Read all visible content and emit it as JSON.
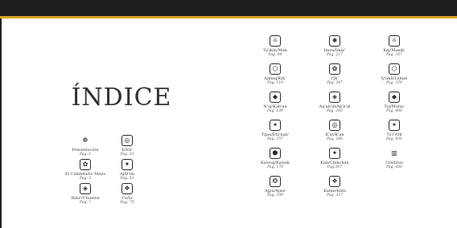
{
  "index_title": "ÍNDICE",
  "page_prefix": "Pag.",
  "left_column_a": [
    {
      "name": "Presentación",
      "page": "Pag. 1",
      "icon": "flower-glyph-icon"
    },
    {
      "name": "El Calendario Maya",
      "page": "Pag. 3",
      "icon": "calendar-glyph-icon"
    },
    {
      "name": "Batz'/Chuwen",
      "page": "Pag. 7",
      "icon": "batz-glyph-icon"
    }
  ],
  "left_column_b": [
    {
      "name": "E/Eb'",
      "page": "Pag. 33",
      "icon": "e-glyph-icon"
    },
    {
      "name": "Aj/B'en",
      "page": "Pag. 53",
      "icon": "aj-glyph-icon"
    },
    {
      "name": "I'x/Ix",
      "page": "Pag. 75",
      "icon": "ix-glyph-icon"
    }
  ],
  "right_column_1": [
    {
      "name": "Tz'ikin/Men",
      "page": "Pag. 99",
      "icon": "tzikin-glyph-icon"
    },
    {
      "name": "Ajmaq/Kib'",
      "page": "Pag. 119",
      "icon": "ajmaq-glyph-icon"
    },
    {
      "name": "N'oj/Kab'an",
      "page": "Pag. 139",
      "icon": "noj-glyph-icon"
    },
    {
      "name": "Tijax/Etz'nab'",
      "page": "Pag. 157",
      "icon": "tijax-glyph-icon"
    },
    {
      "name": "Kawoq/Kawak",
      "page": "Pag. 179",
      "icon": "kawoq-glyph-icon"
    },
    {
      "name": "Ajpu/Ajaw",
      "page": "Pag. 199",
      "icon": "ajpu-glyph-icon"
    }
  ],
  "right_column_2": [
    {
      "name": "Imox/Imix'",
      "page": "Pag. 227",
      "icon": "imox-glyph-icon"
    },
    {
      "name": "I'jk'",
      "page": "Pag. 247",
      "icon": "ijk-glyph-icon"
    },
    {
      "name": "Aq'ab'al/Ak'b'al",
      "page": "Pag. 265",
      "icon": "aqabal-glyph-icon"
    },
    {
      "name": "K'at/K'an",
      "page": "Pag. 285",
      "icon": "kat-glyph-icon"
    },
    {
      "name": "Kan/Chikchan",
      "page": "Pag.307",
      "icon": "kan-glyph-icon"
    },
    {
      "name": "Kame/Kimi",
      "page": "Pag. 327",
      "icon": "kame-glyph-icon"
    }
  ],
  "right_column_3": [
    {
      "name": "Kej/Manik'",
      "page": "Pag. 357",
      "icon": "kej-glyph-icon"
    },
    {
      "name": "Q'anil/Lamat",
      "page": "Pag. 379",
      "icon": "qanil-glyph-icon"
    },
    {
      "name": "Toj/Muluc",
      "page": "Pag. 405",
      "icon": "toj-glyph-icon"
    },
    {
      "name": "Tz'i'/Ok",
      "page": "Pag. 431",
      "icon": "tzi-glyph-icon"
    },
    {
      "name": "Créditos",
      "page": "Pag. 450",
      "icon": "credits-book-icon"
    }
  ],
  "colors": {
    "bar": "#1f1f1f",
    "accent": "#d8a31b",
    "text": "#333333"
  }
}
